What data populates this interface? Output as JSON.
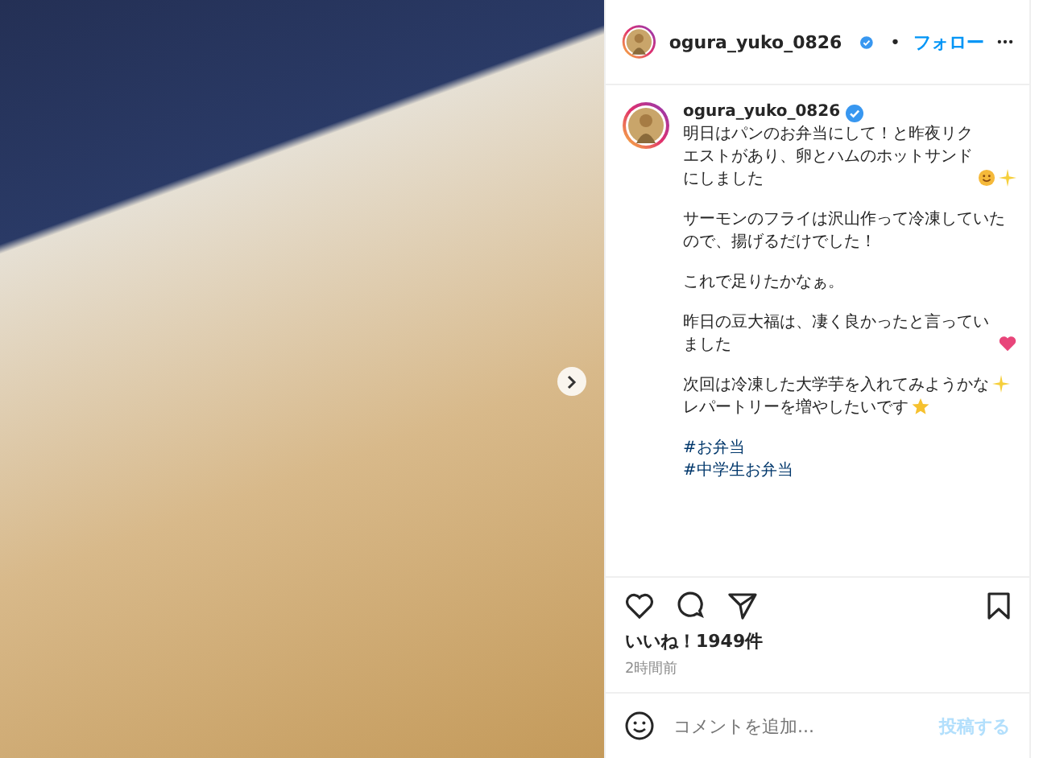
{
  "post": {
    "photo": {
      "has_next": true
    },
    "header": {
      "username": "ogura_yuko_0826",
      "verified": true,
      "separator": "•",
      "follow": "フォロー"
    },
    "caption": {
      "username": "ogura_yuko_0826",
      "verified": true,
      "paragraphs": [
        {
          "lines": [
            {
              "text": "明日はパンのお弁当にして！と昨夜リクエストがあり、卵とハムのホットサンドにしました",
              "icons": [
                {
                  "kind": "smile"
                },
                {
                  "kind": "sparkles"
                }
              ]
            }
          ]
        },
        {
          "lines": [
            {
              "text": "サーモンのフライは沢山作って冷凍していたので、揚げるだけでした！"
            }
          ]
        },
        {
          "lines": [
            {
              "text": "これで足りたかなぁ。"
            }
          ]
        },
        {
          "lines": [
            {
              "text": "昨日の豆大福は、凄く良かったと言っていました",
              "icons": [
                {
                  "kind": "heart"
                }
              ]
            }
          ]
        },
        {
          "lines": [
            {
              "text": "次回は冷凍した大学芋を入れてみようかな",
              "icons": [
                {
                  "kind": "sparkles"
                }
              ]
            },
            {
              "text": "レパートリーを増やしたいです",
              "icons": [
                {
                  "kind": "star"
                }
              ]
            }
          ]
        }
      ],
      "hashtags": [
        "#お弁当",
        "#中学生お弁当"
      ]
    },
    "likes": "いいね！1949件",
    "time": "2時間前",
    "comment": {
      "placeholder": "コメントを追加...",
      "post_button": "投稿する",
      "post_disabled": true
    }
  }
}
